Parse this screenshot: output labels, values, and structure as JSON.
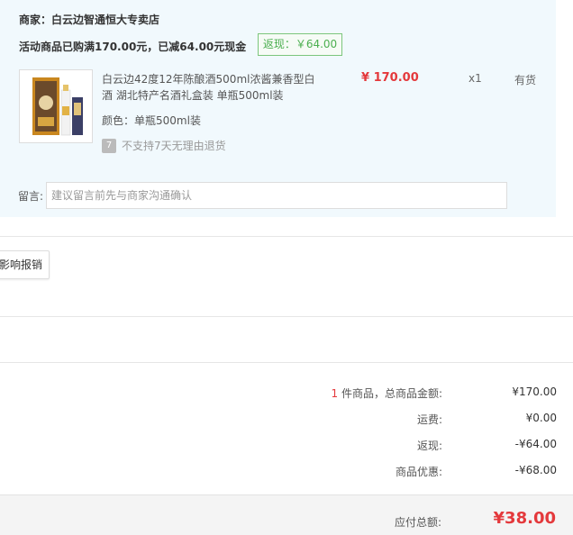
{
  "shop": {
    "label": "商家：",
    "name": "白云边智通恒大专卖店"
  },
  "promo": {
    "text": "活动商品已购满170.00元，已减64.00元现金",
    "rebate_badge": "返现：￥64.00"
  },
  "item": {
    "title": "白云边42度12年陈酿酒500ml浓酱兼香型白酒 湖北特产名酒礼盒装 单瓶500ml装",
    "price": "¥ 170.00",
    "quantity": "x1",
    "stock": "有货",
    "color_label": "颜色：",
    "color_value": "单瓶500ml装",
    "return_icon_glyph": "7",
    "return_policy": "不支持7天无理由退货"
  },
  "message": {
    "label": "留言:",
    "placeholder": "建议留言前先与商家沟通确认"
  },
  "invoice_button": "影响报销",
  "summary": {
    "count": "1",
    "count_suffix": " 件商品，总商品金额:",
    "goods_total": "¥170.00",
    "shipping_label": "运费:",
    "shipping_value": "¥0.00",
    "rebate_label": "返现:",
    "rebate_value": "-¥64.00",
    "discount_label": "商品优惠:",
    "discount_value": "-¥68.00"
  },
  "total": {
    "label": "应付总额:",
    "value": "¥38.00"
  },
  "colors": {
    "price_red": "#e4393c",
    "rebate_green": "#4caf50",
    "panel_bg": "#f1f9fd"
  }
}
